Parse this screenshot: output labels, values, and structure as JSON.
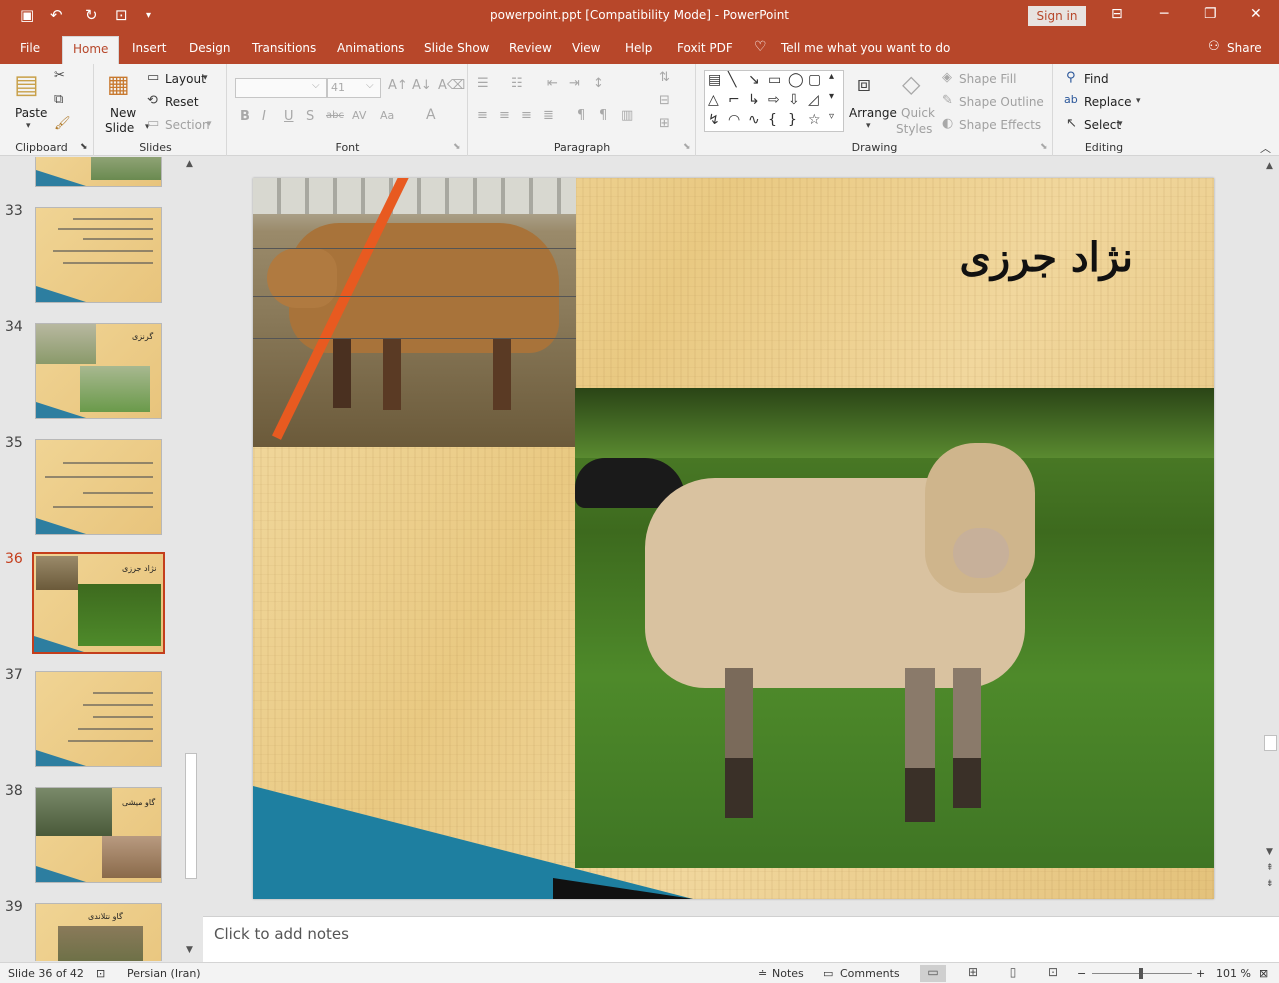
{
  "window": {
    "title": "powerpoint.ppt [Compatibility Mode]  -  PowerPoint",
    "signin": "Sign in"
  },
  "tabs": [
    "File",
    "Home",
    "Insert",
    "Design",
    "Transitions",
    "Animations",
    "Slide Show",
    "Review",
    "View",
    "Help",
    "Foxit PDF"
  ],
  "active_tab": "Home",
  "tellme": "Tell me what you want to do",
  "share": "Share",
  "ribbon": {
    "clipboard": {
      "label": "Clipboard",
      "paste": "Paste"
    },
    "slides": {
      "label": "Slides",
      "new_slide": "New",
      "new_slide2": "Slide",
      "layout": "Layout",
      "reset": "Reset",
      "section": "Section"
    },
    "font": {
      "label": "Font",
      "size": "41"
    },
    "paragraph": {
      "label": "Paragraph"
    },
    "drawing": {
      "label": "Drawing",
      "arrange": "Arrange",
      "quick_styles": "Quick",
      "quick_styles2": "Styles",
      "shape_fill": "Shape Fill",
      "shape_outline": "Shape Outline",
      "shape_effects": "Shape Effects"
    },
    "editing": {
      "label": "Editing",
      "find": "Find",
      "replace": "Replace",
      "select": "Select"
    }
  },
  "thumbnails": [
    {
      "num": "33"
    },
    {
      "num": "34",
      "title": "گرنزی"
    },
    {
      "num": "35"
    },
    {
      "num": "36",
      "title": "نژاد جرزی",
      "selected": true
    },
    {
      "num": "37"
    },
    {
      "num": "38",
      "title": "گاو میشی"
    },
    {
      "num": "39",
      "title": "گاو نتلاندی"
    }
  ],
  "slide": {
    "title": "نژاد جرزی"
  },
  "notes_placeholder": "Click to add notes",
  "status": {
    "slide": "Slide 36 of 42",
    "language": "Persian (Iran)",
    "notes": "Notes",
    "comments": "Comments",
    "zoom": "101 %"
  }
}
